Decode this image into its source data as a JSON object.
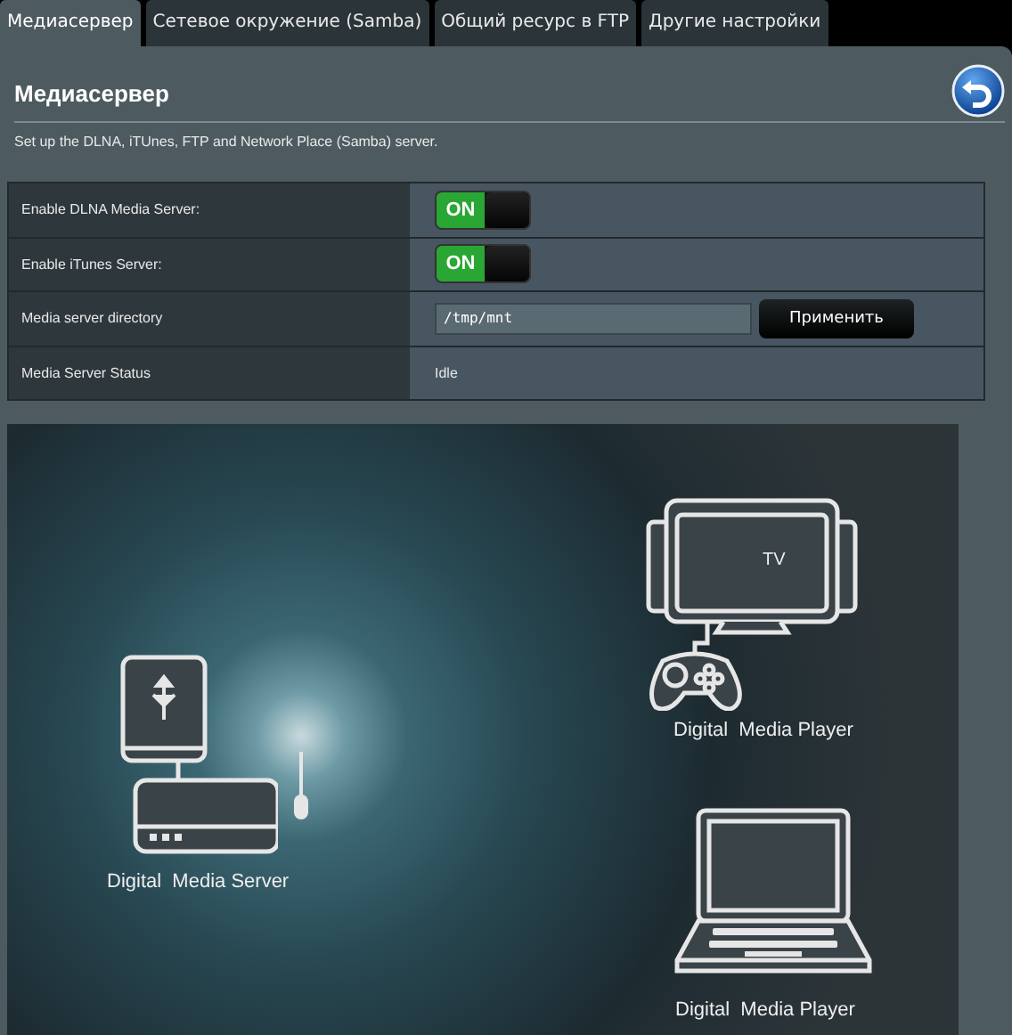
{
  "tabs": [
    {
      "label": "Медиасервер",
      "selected": true
    },
    {
      "label": "Сетевое окружение (Samba)",
      "selected": false
    },
    {
      "label": "Общий ресурс в FTP",
      "selected": false
    },
    {
      "label": "Другие настройки",
      "selected": false
    }
  ],
  "page": {
    "title": "Медиасервер",
    "description": "Set up the DLNA, iTUnes, FTP and Network Place (Samba) server."
  },
  "settings": [
    {
      "kind": "toggle",
      "label": "Enable DLNA Media Server:",
      "on": true,
      "state_text": "ON"
    },
    {
      "kind": "toggle",
      "label": "Enable iTunes Server:",
      "on": true,
      "state_text": "ON"
    },
    {
      "kind": "input",
      "label": "Media server directory",
      "value": "/tmp/mnt",
      "button": "Применить"
    },
    {
      "kind": "text",
      "label": "Media Server Status",
      "value": "Idle"
    }
  ],
  "diagram": {
    "server_label": "Digital  Media Server",
    "tv_text": "TV",
    "player_labels": [
      "Digital  Media Player",
      "Digital  Media Player"
    ]
  }
}
